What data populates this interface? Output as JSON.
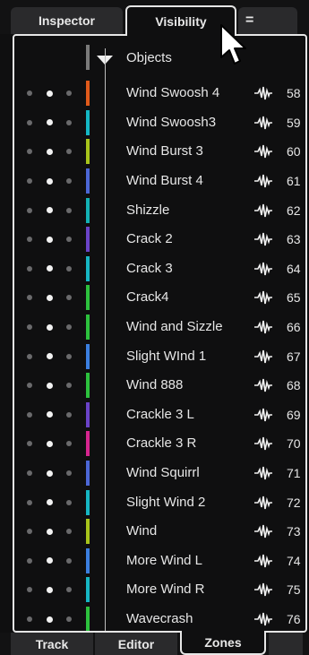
{
  "top_tabs": {
    "inspector": "Inspector",
    "visibility": "Visibility",
    "menu": "="
  },
  "list_header": {
    "label": "Objects"
  },
  "rows": [
    {
      "name": "Wind Swoosh 4",
      "number": "58",
      "color": "#e05a1a"
    },
    {
      "name": "Wind Swoosh3",
      "number": "59",
      "color": "#14b7c4"
    },
    {
      "name": "Wind Burst 3",
      "number": "60",
      "color": "#a7c41b"
    },
    {
      "name": "Wind Burst 4",
      "number": "61",
      "color": "#4c67d6"
    },
    {
      "name": "Shizzle",
      "number": "62",
      "color": "#13b1b4"
    },
    {
      "name": "Crack 2",
      "number": "63",
      "color": "#6a43c8"
    },
    {
      "name": "Crack 3",
      "number": "64",
      "color": "#16b6c3"
    },
    {
      "name": "Crack4",
      "number": "65",
      "color": "#2cc13d"
    },
    {
      "name": "Wind and Sizzle",
      "number": "66",
      "color": "#2cc13d"
    },
    {
      "name": "Slight WInd 1",
      "number": "67",
      "color": "#3b7fe0"
    },
    {
      "name": "Wind 888",
      "number": "68",
      "color": "#2cc13d"
    },
    {
      "name": "Crackle 3 L",
      "number": "69",
      "color": "#6a43c8"
    },
    {
      "name": "Crackle 3 R",
      "number": "70",
      "color": "#d6258f"
    },
    {
      "name": "Wind Squirrl",
      "number": "71",
      "color": "#4c67d6"
    },
    {
      "name": "Slight Wind 2",
      "number": "72",
      "color": "#16b6c3"
    },
    {
      "name": "Wind",
      "number": "73",
      "color": "#a7c41b"
    },
    {
      "name": "More Wind L",
      "number": "74",
      "color": "#3b7fe0"
    },
    {
      "name": "More Wind R",
      "number": "75",
      "color": "#16b6c3"
    },
    {
      "name": "Wavecrash",
      "number": "76",
      "color": "#2cc13d"
    }
  ],
  "bottom_tabs": {
    "track": "Track",
    "editor": "Editor",
    "zones": "Zones"
  }
}
